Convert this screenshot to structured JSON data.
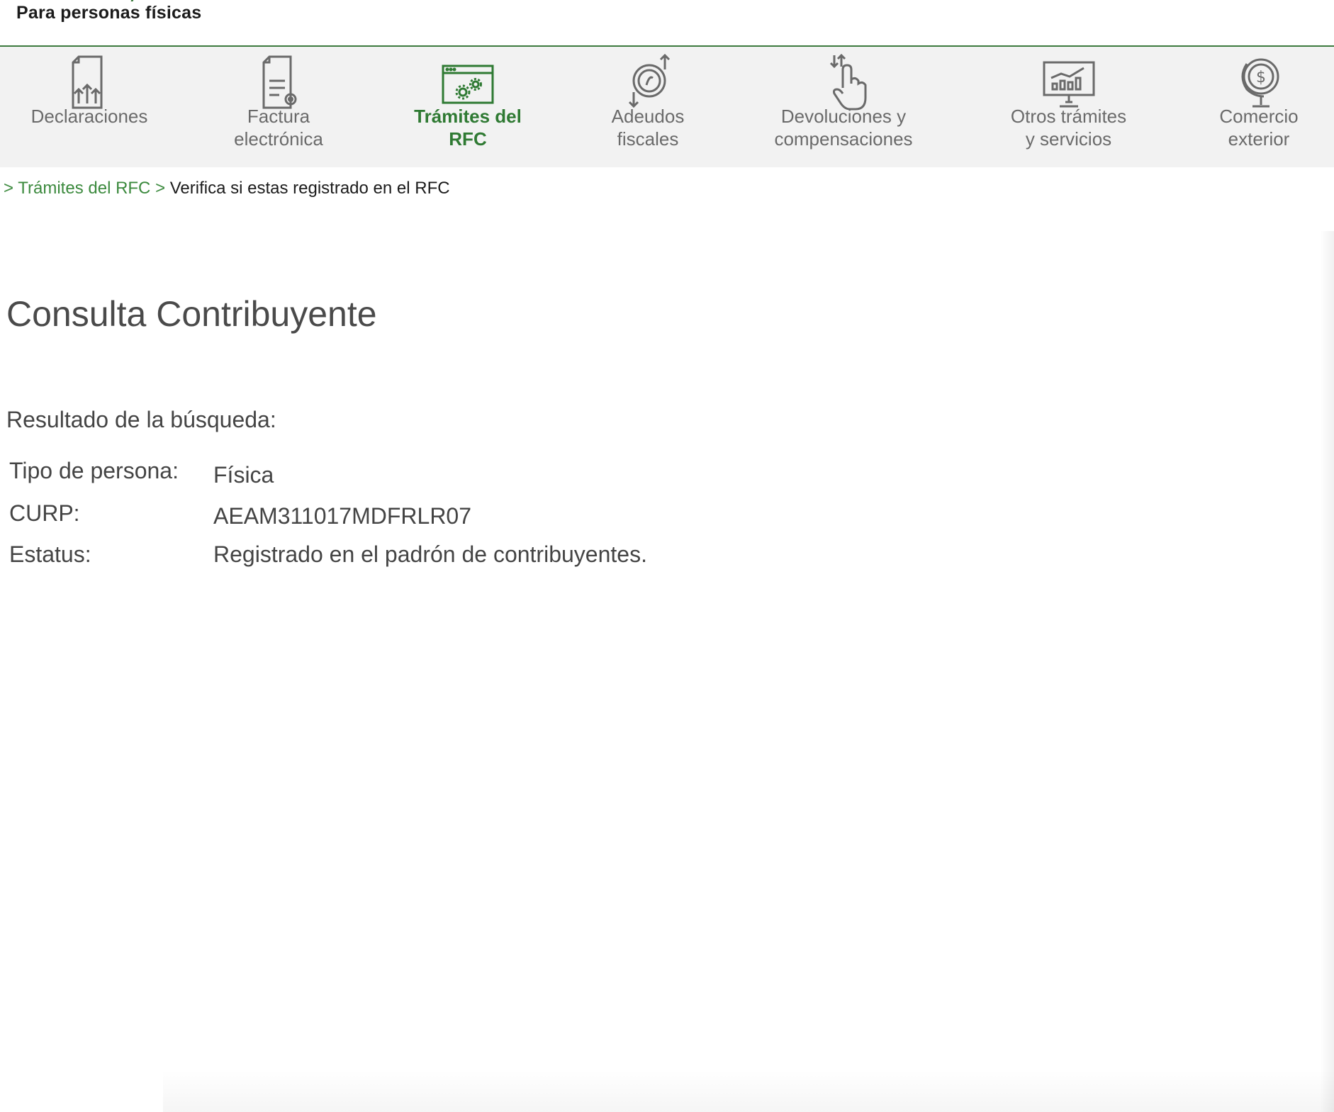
{
  "header": {
    "subtitle": "Para personas físicas"
  },
  "nav": {
    "items": [
      {
        "label": "Declaraciones",
        "icon": "document-upload-icon",
        "active": false
      },
      {
        "label": "Factura\nelectrónica",
        "icon": "e-invoice-icon",
        "active": false
      },
      {
        "label": "Trámites del\nRFC",
        "icon": "browser-gears-icon",
        "active": true
      },
      {
        "label": "Adeudos\nfiscales",
        "icon": "coin-arrows-icon",
        "active": false
      },
      {
        "label": "Devoluciones y\ncompensaciones",
        "icon": "hand-pointer-arrows-icon",
        "active": false
      },
      {
        "label": "Otros trámites\ny servicios",
        "icon": "monitor-chart-icon",
        "active": false
      },
      {
        "label": "Comercio\nexterior",
        "icon": "globe-dollar-icon",
        "active": false
      }
    ]
  },
  "breadcrumb": {
    "separator": ">",
    "link": "Trámites del RFC",
    "current": "Verifica si estas registrado en el RFC"
  },
  "main": {
    "title": "Consulta Contribuyente",
    "result_heading": "Resultado de la búsqueda:",
    "rows": [
      {
        "label": "Tipo de persona:",
        "value": "Física"
      },
      {
        "label": "CURP:",
        "value": "AEAM311017MDFRLR07"
      },
      {
        "label": "Estatus:",
        "value": "Registrado en el padrón de contribuyentes."
      }
    ]
  },
  "colors": {
    "accent": "#2f7a33",
    "nav_background": "#f2f2f2",
    "nav_text": "#6a6a6a",
    "text": "#444444"
  }
}
